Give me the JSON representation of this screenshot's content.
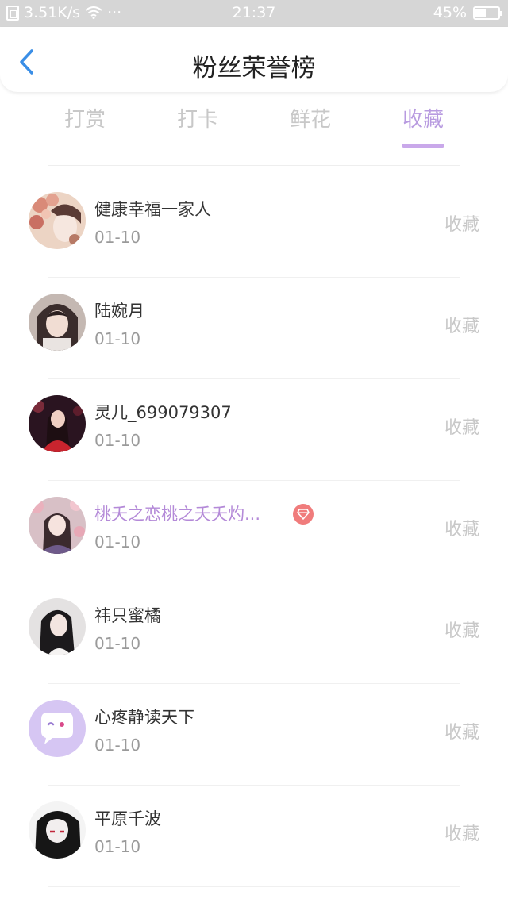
{
  "status_bar": {
    "speed": "3.51K/s",
    "dots": "···",
    "time": "21:37",
    "battery": "45%",
    "battery_level": 0.45
  },
  "header": {
    "title": "粉丝荣誉榜"
  },
  "tabs": [
    {
      "label": "打赏",
      "active": false
    },
    {
      "label": "打卡",
      "active": false
    },
    {
      "label": "鲜花",
      "active": false
    },
    {
      "label": "收藏",
      "active": true
    }
  ],
  "fans": [
    {
      "name": "健康幸福一家人",
      "date": "01-10",
      "action": "收藏",
      "avatar": "avatar-floral-portrait",
      "vip": false
    },
    {
      "name": "陆婉月",
      "date": "01-10",
      "action": "收藏",
      "avatar": "avatar-girl-portrait",
      "vip": false
    },
    {
      "name": "灵儿_699079307",
      "date": "01-10",
      "action": "收藏",
      "avatar": "avatar-red-dress-portrait",
      "vip": false
    },
    {
      "name": "桃夭之恋桃之夭夭灼...",
      "date": "01-10",
      "action": "收藏",
      "avatar": "avatar-blossom-portrait",
      "vip": true
    },
    {
      "name": "祎只蜜橘",
      "date": "01-10",
      "action": "收藏",
      "avatar": "avatar-dark-hair-portrait",
      "vip": false
    },
    {
      "name": "心疼静读天下",
      "date": "01-10",
      "action": "收藏",
      "avatar": "avatar-default-chat",
      "vip": false
    },
    {
      "name": "平原千波",
      "date": "01-10",
      "action": "收藏",
      "avatar": "avatar-anime-portrait",
      "vip": false
    }
  ],
  "colors": {
    "accent": "#b89be0",
    "underline": "#c9a8ea",
    "vip_name": "#b48ad8",
    "vip_badge": "#f07c7c",
    "back_arrow": "#3a8ee6"
  }
}
